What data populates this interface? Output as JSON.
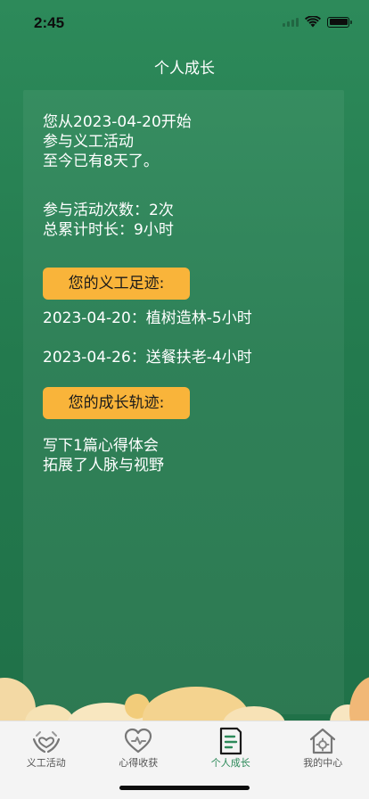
{
  "status_bar": {
    "time": "2:45"
  },
  "nav": {
    "title": "个人成长"
  },
  "summary": {
    "line1": "您从2023-04-20开始",
    "line2": "参与义工活动",
    "line3": "至今已有8天了。"
  },
  "stats": {
    "count": "参与活动次数：2次",
    "duration": "总累计时长：9小时"
  },
  "footprints": {
    "title": "您的义工足迹:",
    "items": [
      "2023-04-20：植树造林-5小时",
      "2023-04-26：送餐扶老-4小时"
    ]
  },
  "growth": {
    "title": "您的成长轨迹:",
    "items": [
      "写下1篇心得体会",
      "拓展了人脉与视野"
    ]
  },
  "tabs": [
    {
      "label": "义工活动",
      "icon": "hands-heart-icon",
      "active": false
    },
    {
      "label": "心得收获",
      "icon": "heart-outline-icon",
      "active": false
    },
    {
      "label": "个人成长",
      "icon": "document-icon",
      "active": true
    },
    {
      "label": "我的中心",
      "icon": "home-gear-icon",
      "active": false
    }
  ],
  "colors": {
    "background": "#237a4e",
    "accent": "#f9b43a",
    "active_tab": "#2d8a5a"
  }
}
